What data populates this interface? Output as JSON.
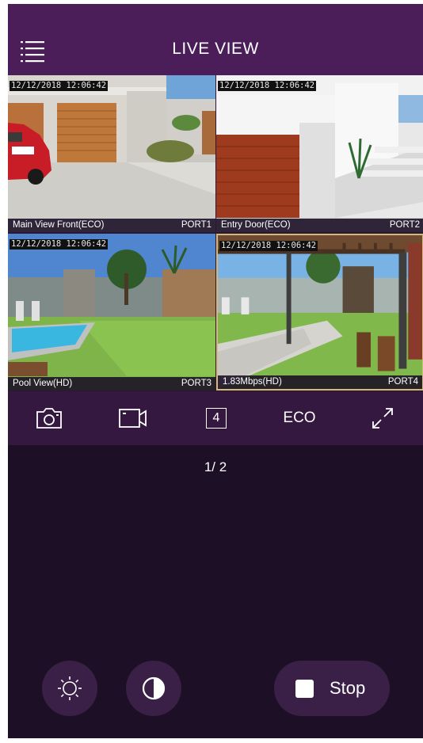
{
  "header": {
    "title": "LIVE VIEW",
    "menu_icon": "hamburger-menu-icon"
  },
  "cameras": [
    {
      "timestamp": "12/12/2018 12:06:42",
      "name": "Main View Front(ECO)",
      "port": "PORT1"
    },
    {
      "timestamp": "12/12/2018 12:06:42",
      "name": "Entry Door(ECO)",
      "port": "PORT2"
    },
    {
      "timestamp": "12/12/2018 12:06:42",
      "name": "Pool View(HD)",
      "port": "PORT3"
    },
    {
      "timestamp": "12/12/2018 12:06:42",
      "name": "1.83Mbps(HD)",
      "port": "PORT4",
      "selected": true
    }
  ],
  "toolbar": {
    "snapshot_icon": "camera-icon",
    "record_icon": "video-record-icon",
    "layout_value": "4",
    "quality_label": "ECO",
    "fullscreen_icon": "expand-icon"
  },
  "pager": {
    "text": "1/ 2"
  },
  "controls": {
    "brightness_icon": "brightness-icon",
    "contrast_icon": "contrast-icon",
    "stop_label": "Stop"
  },
  "colors": {
    "header": "#4b1e5a",
    "toolbar": "#35183f",
    "background": "#1d1026",
    "button": "#3a1f47",
    "selected_border": "#d4b97a"
  }
}
